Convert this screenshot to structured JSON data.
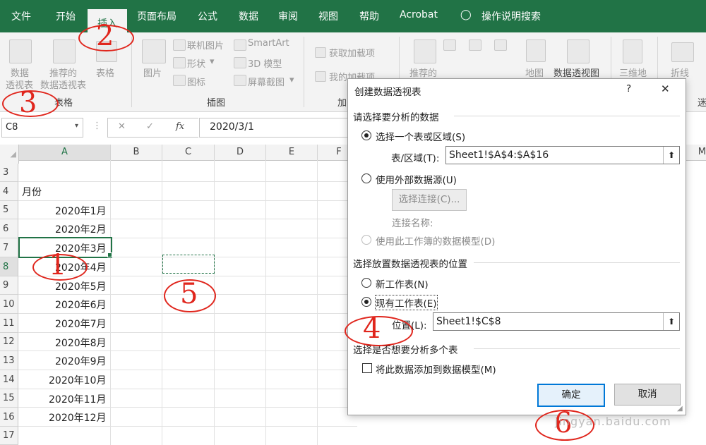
{
  "menu": {
    "items": [
      "文件",
      "开始",
      "插入",
      "页面布局",
      "公式",
      "数据",
      "审阅",
      "视图",
      "帮助",
      "Acrobat"
    ],
    "active": "插入",
    "tell_me": "操作说明搜索"
  },
  "ribbon": {
    "pivot_table": [
      "数据",
      "透视表"
    ],
    "recommended_pivot": [
      "推荐的",
      "数据透视表"
    ],
    "table": "表格",
    "picture": "图片",
    "online_picture": "联机图片",
    "shapes": "形状",
    "icons": "图标",
    "smartart": "SmartArt",
    "model_3d": "3D 模型",
    "screenshot": "屏幕截图",
    "get_addins": "获取加载项",
    "my_addins": "我的加载项",
    "recommended_charts": "推荐的",
    "map": "地图",
    "pivot_chart": "数据透视图",
    "map_3d": "三维地",
    "line": "折线",
    "group_tables": "表格",
    "group_illustrations": "插图",
    "group_addins": "加",
    "group_sparklines": "迷"
  },
  "formula_bar": {
    "name_box": "C8",
    "fx": "fx",
    "value": "2020/3/1"
  },
  "sheet": {
    "columns": [
      "A",
      "B",
      "C",
      "D",
      "E",
      "F"
    ],
    "right_col": "M",
    "rows": [
      "3",
      "4",
      "5",
      "6",
      "7",
      "8",
      "9",
      "10",
      "11",
      "12",
      "13",
      "14",
      "15",
      "16",
      "17"
    ],
    "header_cell": "月份",
    "months": [
      "2020年1月",
      "2020年2月",
      "2020年3月",
      "2020年4月",
      "2020年5月",
      "2020年6月",
      "2020年7月",
      "2020年8月",
      "2020年9月",
      "2020年10月",
      "2020年11月",
      "2020年12月"
    ]
  },
  "dialog": {
    "title": "创建数据透视表",
    "help": "?",
    "close": "✕",
    "section1": "请选择要分析的数据",
    "opt_range": "选择一个表或区域(S)",
    "range_label": "表/区域(T):",
    "range_value": "Sheet1!$A$4:$A$16",
    "opt_external": "使用外部数据源(U)",
    "choose_connection": "选择连接(C)...",
    "connection_name": "连接名称:",
    "opt_model": "使用此工作簿的数据模型(D)",
    "section2": "选择放置数据透视表的位置",
    "opt_new_sheet": "新工作表(N)",
    "opt_existing": "现有工作表(E)",
    "location_label": "位置(L):",
    "location_value": "Sheet1!$C$8",
    "section3": "选择是否想要分析多个表",
    "add_to_model": "将此数据添加到数据模型(M)",
    "ok": "确定",
    "cancel": "取消"
  },
  "annotations": [
    "1",
    "2",
    "3",
    "4",
    "5",
    "6"
  ],
  "watermark": "jingyan.baidu.com",
  "colors": {
    "excel_green": "#217346",
    "annotation_red": "#e0261d"
  }
}
